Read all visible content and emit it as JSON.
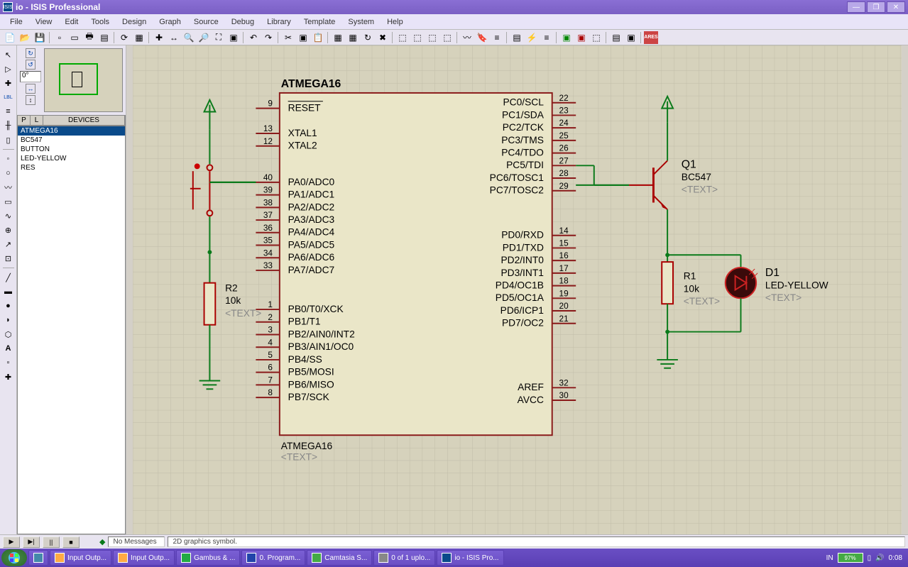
{
  "window": {
    "title": "io - ISIS Professional"
  },
  "menus": [
    "File",
    "View",
    "Edit",
    "Tools",
    "Design",
    "Graph",
    "Source",
    "Debug",
    "Library",
    "Template",
    "System",
    "Help"
  ],
  "side": {
    "angle": "0°",
    "header_p": "P",
    "header_l": "L",
    "header_devices": "DEVICES",
    "devices": [
      "ATMEGA16",
      "BC547",
      "BUTTON",
      "LED-YELLOW",
      "RES"
    ]
  },
  "sim": {
    "no_messages": "No Messages",
    "status": "2D graphics symbol."
  },
  "taskbar": {
    "items": [
      "Input Outp...",
      "Input Outp...",
      "Gambus & ...",
      "0. Program...",
      "Camtasia S...",
      "0 of 1 uplo...",
      "io - ISIS Pro..."
    ],
    "lang": "IN",
    "battery": "97%",
    "time": "0:08"
  },
  "chip": {
    "title": "ATMEGA16",
    "ref": "ATMEGA16",
    "text": "<TEXT>",
    "left_pins": [
      {
        "num": "9",
        "label": "RESET"
      },
      {
        "num": "13",
        "label": "XTAL1"
      },
      {
        "num": "12",
        "label": "XTAL2"
      },
      {
        "num": "40",
        "label": "PA0/ADC0"
      },
      {
        "num": "39",
        "label": "PA1/ADC1"
      },
      {
        "num": "38",
        "label": "PA2/ADC2"
      },
      {
        "num": "37",
        "label": "PA3/ADC3"
      },
      {
        "num": "36",
        "label": "PA4/ADC4"
      },
      {
        "num": "35",
        "label": "PA5/ADC5"
      },
      {
        "num": "34",
        "label": "PA6/ADC6"
      },
      {
        "num": "33",
        "label": "PA7/ADC7"
      },
      {
        "num": "1",
        "label": "PB0/T0/XCK"
      },
      {
        "num": "2",
        "label": "PB1/T1"
      },
      {
        "num": "3",
        "label": "PB2/AIN0/INT2"
      },
      {
        "num": "4",
        "label": "PB3/AIN1/OC0"
      },
      {
        "num": "5",
        "label": "PB4/SS"
      },
      {
        "num": "6",
        "label": "PB5/MOSI"
      },
      {
        "num": "7",
        "label": "PB6/MISO"
      },
      {
        "num": "8",
        "label": "PB7/SCK"
      }
    ],
    "right_pins": [
      {
        "num": "22",
        "label": "PC0/SCL"
      },
      {
        "num": "23",
        "label": "PC1/SDA"
      },
      {
        "num": "24",
        "label": "PC2/TCK"
      },
      {
        "num": "25",
        "label": "PC3/TMS"
      },
      {
        "num": "26",
        "label": "PC4/TDO"
      },
      {
        "num": "27",
        "label": "PC5/TDI"
      },
      {
        "num": "28",
        "label": "PC6/TOSC1"
      },
      {
        "num": "29",
        "label": "PC7/TOSC2"
      },
      {
        "num": "14",
        "label": "PD0/RXD"
      },
      {
        "num": "15",
        "label": "PD1/TXD"
      },
      {
        "num": "16",
        "label": "PD2/INT0"
      },
      {
        "num": "17",
        "label": "PD3/INT1"
      },
      {
        "num": "18",
        "label": "PD4/OC1B"
      },
      {
        "num": "19",
        "label": "PD5/OC1A"
      },
      {
        "num": "20",
        "label": "PD6/ICP1"
      },
      {
        "num": "21",
        "label": "PD7/OC2"
      },
      {
        "num": "32",
        "label": "AREF"
      },
      {
        "num": "30",
        "label": "AVCC"
      }
    ]
  },
  "components": {
    "r2": {
      "ref": "R2",
      "val": "10k",
      "text": "<TEXT>"
    },
    "r1": {
      "ref": "R1",
      "val": "10k",
      "text": "<TEXT>"
    },
    "q1": {
      "ref": "Q1",
      "val": "BC547",
      "text": "<TEXT>"
    },
    "d1": {
      "ref": "D1",
      "val": "LED-YELLOW",
      "text": "<TEXT>"
    }
  }
}
